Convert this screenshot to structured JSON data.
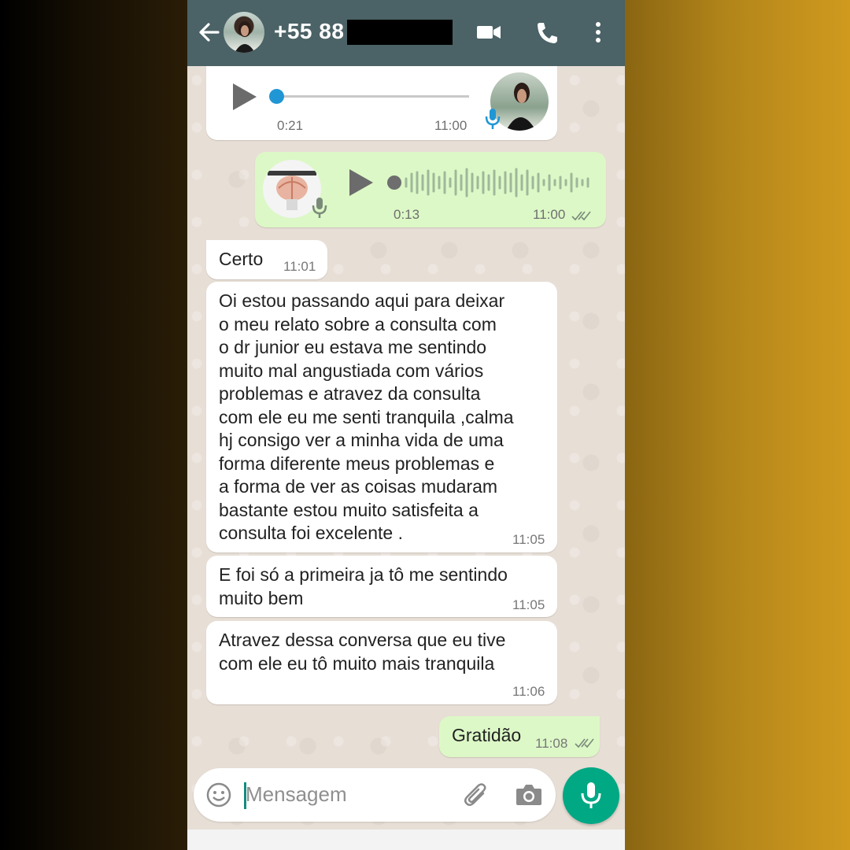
{
  "header": {
    "contact": "+55 88",
    "icons": [
      "back-arrow-icon",
      "video-call-icon",
      "phone-icon",
      "more-options-icon"
    ]
  },
  "messages": [
    {
      "type": "voice",
      "direction": "in",
      "duration": "0:21",
      "time": "11:00"
    },
    {
      "type": "voice",
      "direction": "out",
      "duration": "0:13",
      "time": "11:00"
    },
    {
      "type": "text",
      "direction": "in",
      "text": "Certo",
      "time": "11:01"
    },
    {
      "type": "text",
      "direction": "in",
      "text": "Oi estou passando aqui para deixar\no meu relato sobre a consulta com\no dr junior eu estava me sentindo\nmuito mal angustiada com vários\nproblemas  e atravez da consulta\ncom ele eu me senti tranquila ,calma\nhj consigo ver a minha vida de uma\nforma diferente meus problemas e\na forma de ver as coisas mudaram\nbastante  estou muito satisfeita a\nconsulta foi excelente .",
      "time": "11:05"
    },
    {
      "type": "text",
      "direction": "in",
      "text": "E foi só  a primeira ja tô me sentindo\nmuito bem",
      "time": "11:05"
    },
    {
      "type": "text",
      "direction": "in",
      "text": "Atravez dessa conversa que eu tive\ncom ele eu tô muito mais tranquila",
      "time": "11:06"
    },
    {
      "type": "text",
      "direction": "out",
      "text": "Gratidão",
      "time": "11:08"
    }
  ],
  "composer": {
    "placeholder": "Mensagem",
    "icons": [
      "emoji-icon",
      "attach-icon",
      "camera-icon",
      "mic-icon"
    ]
  },
  "colors": {
    "header": "#4b6266",
    "outgoing_bubble": "#dcf8c6",
    "incoming_bubble": "#ffffff",
    "accent": "#00a884"
  }
}
